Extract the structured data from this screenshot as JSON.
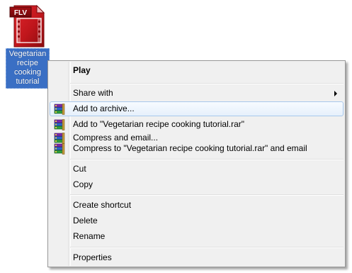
{
  "desktop": {
    "file": {
      "badge": "FLV",
      "label": "Vegetarian recipe cooking tutorial"
    }
  },
  "context_menu": {
    "play": "Play",
    "share_with": "Share with",
    "add_to_archive": "Add to archive...",
    "add_to_rar": "Add to \"Vegetarian recipe cooking tutorial.rar\"",
    "compress_and_email": "Compress and email...",
    "compress_to_rar_and_email": "Compress to \"Vegetarian recipe cooking tutorial.rar\" and email",
    "cut": "Cut",
    "copy": "Copy",
    "create_shortcut": "Create shortcut",
    "delete": "Delete",
    "rename": "Rename",
    "properties": "Properties"
  },
  "icons": {
    "file": "flv-video-file-icon",
    "archive": "winrar-books-icon",
    "submenu": "chevron-right-icon"
  },
  "colors": {
    "file_icon_red": "#c0161c",
    "selection_blue": "#3a6fc4",
    "menu_background": "#f0f0f0",
    "highlight_border": "#a8c8ec"
  }
}
